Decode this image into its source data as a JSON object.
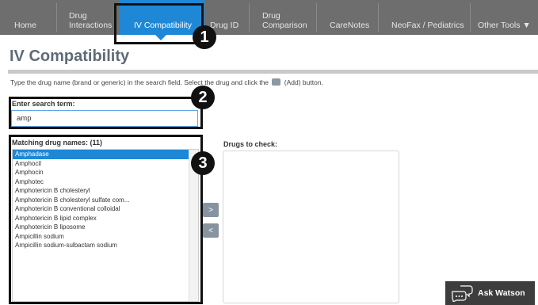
{
  "nav": {
    "items": [
      {
        "label": "Home"
      },
      {
        "label": "Drug\nInteractions"
      },
      {
        "label": "IV Compatibility"
      },
      {
        "label": "Drug ID"
      },
      {
        "label": "Drug\nComparison"
      },
      {
        "label": "CareNotes"
      },
      {
        "label": "NeoFax / Pediatrics"
      },
      {
        "label": "Other Tools ▼"
      }
    ]
  },
  "page": {
    "title": "IV Compatibility",
    "instructions_before": "Type the drug name (brand or generic) in the search field. Select the drug and click the",
    "instructions_after": "(Add) button."
  },
  "search": {
    "label": "Enter search term:",
    "value": "amp"
  },
  "matching": {
    "label": "Matching drug names: (11)",
    "items": [
      "Amphadase",
      "Amphocil",
      "Amphocin",
      "Amphotec",
      "Amphotericin B cholesteryl",
      "Amphotericin B cholesteryl sulfate com...",
      "Amphotericin B conventional colloidal",
      "Amphotericin B lipid complex",
      "Amphotericin B liposome",
      "Ampicillin sodium",
      "Ampicillin sodium-sulbactam sodium"
    ],
    "selected_index": 0
  },
  "buttons": {
    "add": ">",
    "remove": "<"
  },
  "drugs_to_check": {
    "label": "Drugs to check:"
  },
  "callouts": {
    "one": "1",
    "two": "2",
    "three": "3"
  },
  "watson": {
    "label": "Ask Watson"
  },
  "colors": {
    "nav_bg": "#6e6e6e",
    "active_tab": "#1e88d6",
    "selection": "#1e88d6",
    "title": "#5f6b78"
  }
}
